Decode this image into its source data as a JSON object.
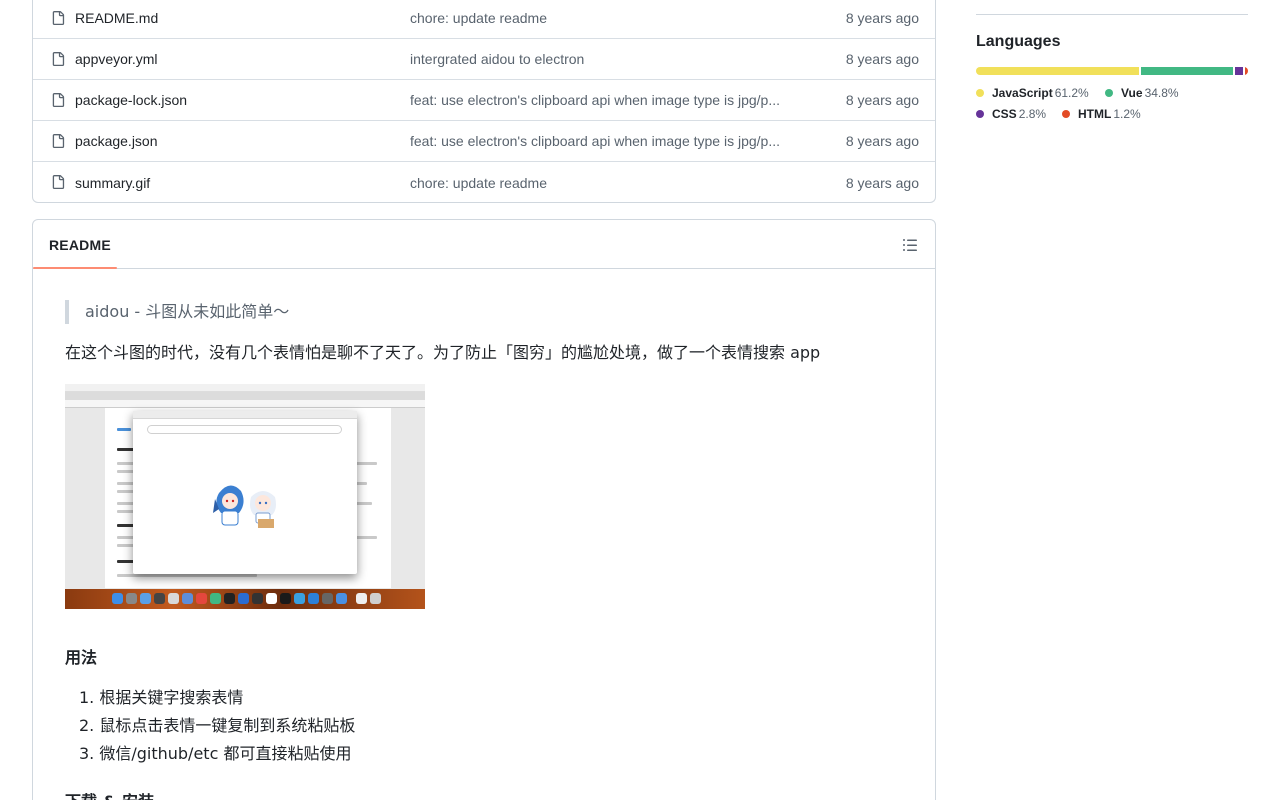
{
  "files": [
    {
      "name": "README.md",
      "message": "chore: update readme",
      "time": "8 years ago"
    },
    {
      "name": "appveyor.yml",
      "message": "intergrated aidou to electron",
      "time": "8 years ago"
    },
    {
      "name": "package-lock.json",
      "message": "feat: use electron's clipboard api when image type is jpg/p...",
      "time": "8 years ago"
    },
    {
      "name": "package.json",
      "message": "feat: use electron's clipboard api when image type is jpg/p...",
      "time": "8 years ago"
    },
    {
      "name": "summary.gif",
      "message": "chore: update readme",
      "time": "8 years ago"
    }
  ],
  "readme": {
    "tab_label": "README",
    "outline_icon": "list-unordered-icon",
    "quote": "aidou - 斗图从未如此简单～",
    "intro": "在这个斗图的时代，没有几个表情怕是聊不了天了。为了防止「图穷」的尴尬处境，做了一个表情搜索 app",
    "usage_heading": "用法",
    "usage_items": [
      "1. 根据关键字搜索表情",
      "2. 鼠标点击表情一键复制到系统粘贴板",
      "3. 微信/github/etc 都可直接粘贴使用"
    ],
    "download_heading": "下载 & 安装"
  },
  "languages": {
    "title": "Languages",
    "items": [
      {
        "name": "JavaScript",
        "percent": "61.2%",
        "value": 61.2,
        "color": "#f1e05a"
      },
      {
        "name": "Vue",
        "percent": "34.8%",
        "value": 34.8,
        "color": "#41b883"
      },
      {
        "name": "CSS",
        "percent": "2.8%",
        "value": 2.8,
        "color": "#663399"
      },
      {
        "name": "HTML",
        "percent": "1.2%",
        "value": 1.2,
        "color": "#e34c26"
      }
    ]
  }
}
